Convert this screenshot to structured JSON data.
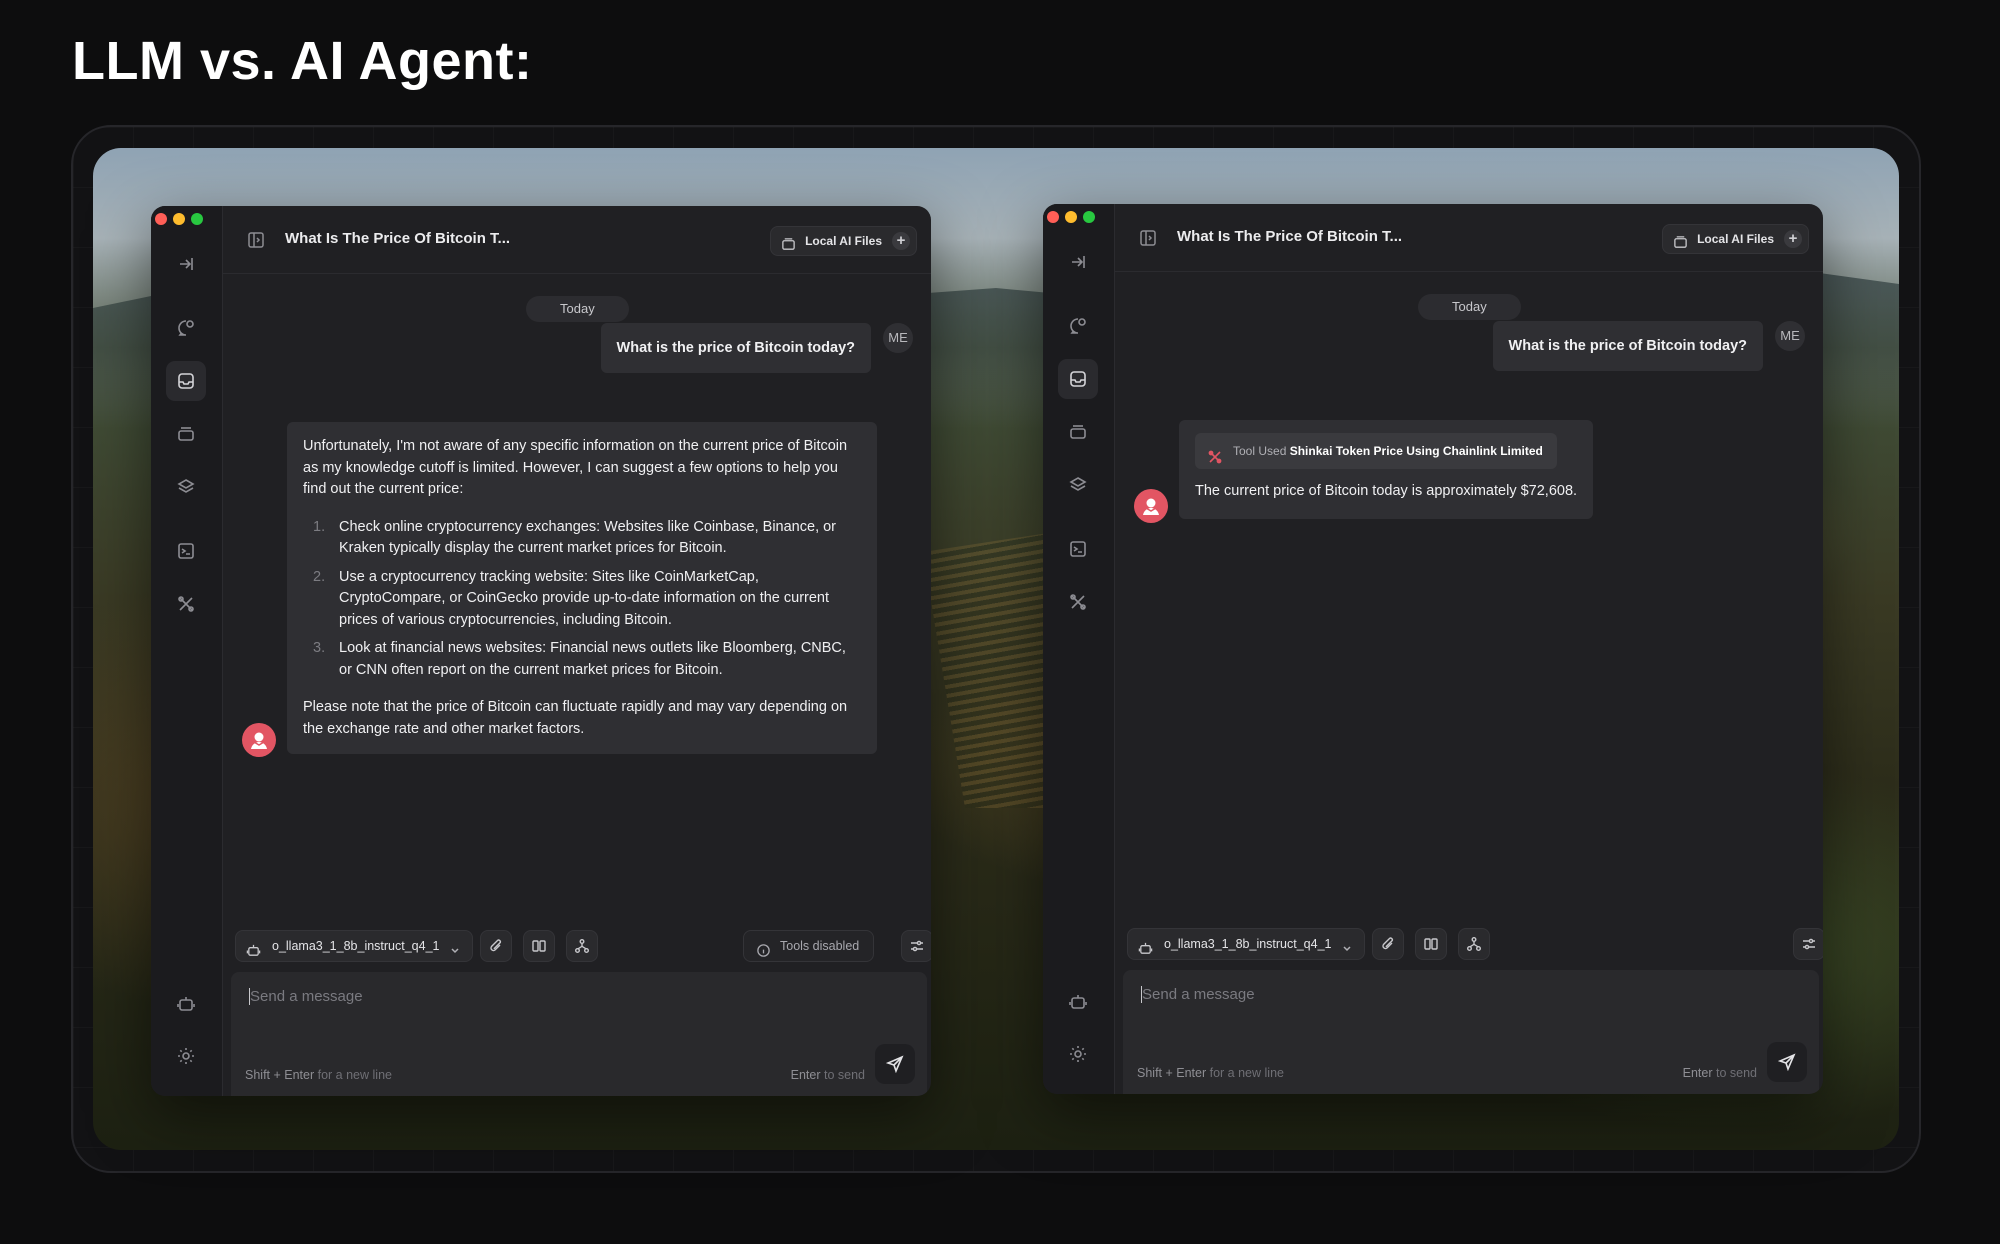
{
  "heading": "LLM vs. AI Agent:",
  "shared": {
    "chat_title": "What Is The Price Of Bitcoin T...",
    "files_label": "Local AI Files",
    "files_plus": "+",
    "day_label": "Today",
    "user_message": "What is the price of Bitcoin today?",
    "me_label": "ME",
    "model_name": "o_llama3_1_8b_instruct_q4_1",
    "placeholder": "Send a message",
    "hint_newline_key": "Shift + Enter",
    "hint_newline_text": "for a new line",
    "hint_send_key": "Enter",
    "hint_send_text": "to send"
  },
  "left_window": {
    "tools_label": "Tools disabled",
    "response": {
      "intro": "Unfortunately, I'm not aware of any specific information on the current price of Bitcoin as my knowledge cutoff is limited. However, I can suggest a few options to help you find out the current price:",
      "items": [
        {
          "num": "1.",
          "text": "Check online cryptocurrency exchanges: Websites like Coinbase, Binance, or Kraken typically display the current market prices for Bitcoin."
        },
        {
          "num": "2.",
          "text": "Use a cryptocurrency tracking website: Sites like CoinMarketCap, CryptoCompare, or CoinGecko provide up-to-date information on the current prices of various cryptocurrencies, including Bitcoin."
        },
        {
          "num": "3.",
          "text": "Look at financial news websites: Financial news outlets like Bloomberg, CNBC, or CNN often report on the current market prices for Bitcoin."
        }
      ],
      "outro": "Please note that the price of Bitcoin can fluctuate rapidly and may vary depending on the exchange rate and other market factors."
    }
  },
  "right_window": {
    "tool_used_prefix": "Tool Used",
    "tool_name": "Shinkai Token Price Using Chainlink Limited",
    "response": "The current price of Bitcoin today is approximately $72,608."
  },
  "colors": {
    "accent_red": "#e25563",
    "window_bg": "#202023",
    "bubble_bg": "#2f2f33"
  },
  "icons": [
    "sidebar-collapse-icon",
    "new-chat-icon",
    "inbox-icon",
    "archive-icon",
    "layers-icon",
    "terminal-icon",
    "tools-icon",
    "robot-icon",
    "gear-icon",
    "panel-icon",
    "folder-icon",
    "paperclip-icon",
    "book-icon",
    "workflow-icon",
    "info-icon",
    "sliders-icon",
    "send-icon",
    "tool-icon"
  ]
}
